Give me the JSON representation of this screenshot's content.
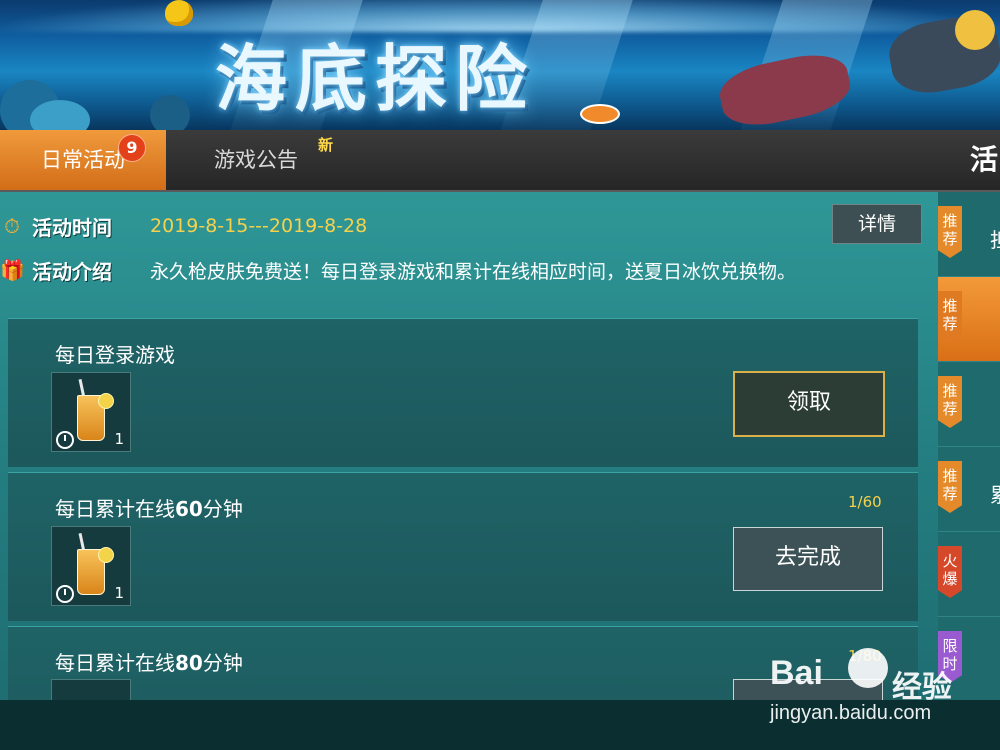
{
  "banner": {
    "title": "海底探险"
  },
  "tabs": [
    {
      "label": "日常活动",
      "badge": "9",
      "active": true
    },
    {
      "label": "游戏公告",
      "badge": "新",
      "active": false
    }
  ],
  "tab_edge_text": "活",
  "info": {
    "time_label": "活动时间",
    "time_value": "2019-8-15---2019-8-28",
    "intro_label": "活动介绍",
    "intro_value": "永久枪皮肤免费送！每日登录游戏和累计在线相应时间，送夏日冰饮兑换物。",
    "detail_button": "详情"
  },
  "tasks": [
    {
      "title_pre": "每日登录游戏",
      "title_num": "",
      "title_post": "",
      "item_count": "1",
      "progress": "",
      "button": "领取"
    },
    {
      "title_pre": "每日累计在线",
      "title_num": "60",
      "title_post": "分钟",
      "item_count": "1",
      "progress": "1/60",
      "button": "去完成"
    },
    {
      "title_pre": "每日累计在线",
      "title_num": "80",
      "title_post": "分钟",
      "item_count": "",
      "progress": "1/80",
      "button": ""
    }
  ],
  "sidenav": [
    {
      "tag": "推荐",
      "text": "担",
      "color": "orange"
    },
    {
      "tag": "推荐",
      "text": "",
      "color": "dark"
    },
    {
      "tag": "推荐",
      "text": "",
      "color": "orange"
    },
    {
      "tag": "推荐",
      "text": "累",
      "color": "orange"
    },
    {
      "tag": "火爆",
      "text": "",
      "color": "red"
    },
    {
      "tag": "限时",
      "text": "",
      "color": "purple"
    }
  ],
  "watermark": {
    "logo": "Bai",
    "logo_after": "经验",
    "url": "jingyan.baidu.com"
  },
  "colors": {
    "accent_orange": "#e8862a",
    "highlight_yellow": "#f6d14a",
    "panel_teal": "#247f82"
  }
}
